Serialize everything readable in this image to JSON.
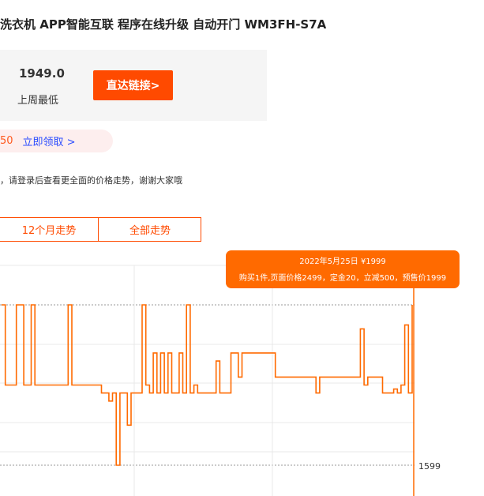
{
  "product": {
    "title": "洗衣机 APP智能互联 程序在线升级 自动开门 WM3FH-S7A"
  },
  "price_box": {
    "low_price": "1949.0",
    "low_label": "上周最低",
    "direct_button": "直达链接>"
  },
  "coupon": {
    "amount": "50",
    "link": "立即领取 >"
  },
  "notice": "，请登录后查看更全面的价格走势，谢谢大家哦",
  "tabs": {
    "twelve_months": "12个月走势",
    "all": "全部走势"
  },
  "tooltip": {
    "date_price": "2022年5月25日 ¥1999",
    "detail": "购买1件,页面价格2499，定金20，立减500，预售价1999"
  },
  "colors": {
    "accent": "#ff4a00",
    "line": "#ff6a00",
    "annotation": "#1a73e8"
  },
  "chart_data": {
    "type": "line",
    "ytick": "1599",
    "series": [
      {
        "values": [
          1999,
          1799,
          1799,
          1799,
          1999,
          1999,
          1799,
          1799,
          1999,
          1799,
          1799,
          1799,
          1799,
          1799,
          1799,
          1799,
          1799,
          1799,
          1999,
          1799,
          1799,
          1799,
          1799,
          1799,
          1799,
          1799,
          1799,
          1779,
          1779,
          1759,
          1779,
          1599,
          1779,
          1779,
          1699,
          1779,
          1779,
          1779,
          1999,
          1799,
          1779,
          1879,
          1779,
          1879,
          1779,
          1879,
          1779,
          1779,
          1879,
          1779,
          1999,
          1779,
          1799,
          1779,
          1779,
          1779,
          1779,
          1779,
          1859,
          1779,
          1779,
          1779,
          1879,
          1879,
          1819,
          1879,
          1879,
          1879,
          1879,
          1879,
          1879,
          1879,
          1879,
          1879,
          1819,
          1819,
          1819,
          1819,
          1819,
          1819,
          1819,
          1819,
          1819,
          1819,
          1819,
          1779,
          1819,
          1819,
          1819,
          1819,
          1819,
          1819,
          1819,
          1819,
          1819,
          1819,
          1819,
          1939,
          1799,
          1819,
          1819,
          1819,
          1819,
          1779,
          1779,
          1779,
          1789,
          1779,
          1799,
          1949,
          1779,
          1999
        ]
      }
    ]
  }
}
